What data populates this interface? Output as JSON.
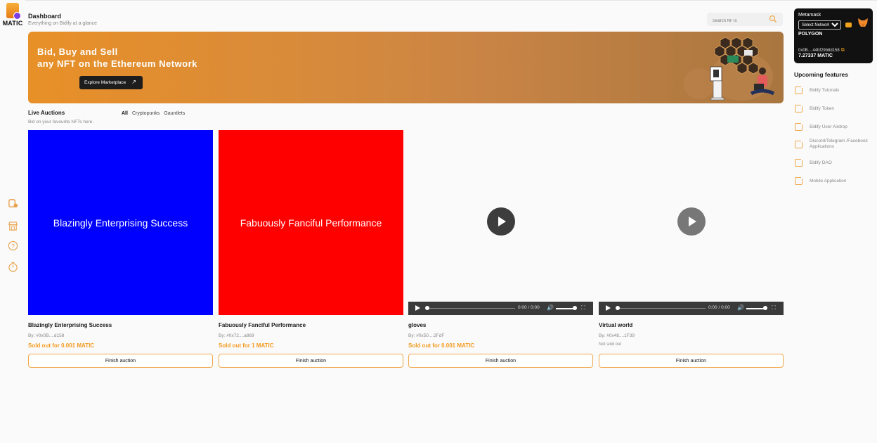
{
  "brand": {
    "label": "MATIC"
  },
  "header": {
    "title": "Dashboard",
    "subtitle": "Everything on Bidify at a glance",
    "search_placeholder": "Search NFTs"
  },
  "hero": {
    "line1": "Bid, Buy and Sell",
    "line2": "any NFT on the Ethereum Network",
    "button_label": "Explore Marketplace",
    "button_arrow": "↗"
  },
  "auctions": {
    "title": "Live Auctions",
    "subtitle": "Bid on your favourite NFTs here.",
    "filters": [
      "All",
      "Cryptopunks",
      "Gauntlets"
    ],
    "cards": [
      {
        "media_text": "Blazingly Enterprising Success",
        "title": "Blazingly Enterprising Success",
        "by": "By: #0x0B....d158",
        "status": "Sold out for 0.001 MATIC",
        "button": "Finish auction"
      },
      {
        "media_text": "Fabuously Fanciful Performance",
        "title": "Fabuously Fanciful Performance",
        "by": "By: #0x72....a869",
        "status": "Sold out for 1 MATIC",
        "button": "Finish auction"
      },
      {
        "title": "gloves",
        "by": "By: #0x50....2FdF",
        "status": "Sold out for 0.001 MATIC",
        "button": "Finish auction",
        "time": "0:00 / 0:00"
      },
      {
        "title": "Virtual world",
        "by": "By: #0x48....1F39",
        "status": "Not sold out",
        "button": "Finish auction",
        "time": "0:00 / 0:00"
      }
    ]
  },
  "wallet": {
    "name": "Metamask",
    "network_select": "Select Network",
    "network": "POLYGON",
    "address": "0x0B....44bf29b8d158",
    "balance": "7.27337 MATIC"
  },
  "upcoming": {
    "title": "Upcoming features",
    "items": [
      "Bidify Tutorials",
      "Bidify Token",
      "Bidify User Airdrop",
      "Discord/Telegram /Facebook Applications",
      "Bidify DAO",
      "Mobile Application"
    ]
  },
  "colors": {
    "accent": "#f39a1d",
    "card1": "#0000ff",
    "card2": "#ff0000",
    "dark": "#111111"
  },
  "icons": {
    "rail": [
      "bidify-icon",
      "marketplace-icon",
      "help-icon",
      "timer-icon"
    ]
  }
}
